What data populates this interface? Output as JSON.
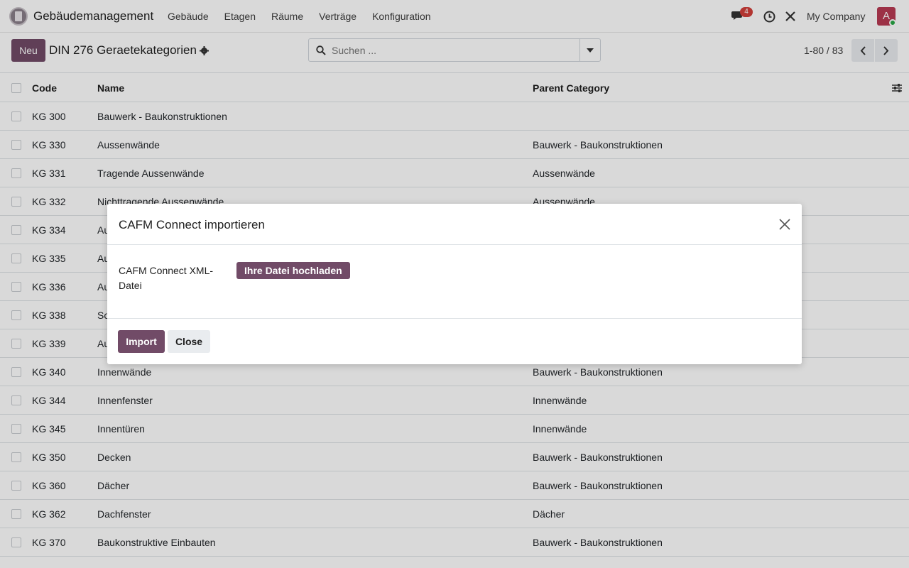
{
  "navbar": {
    "app_name": "Gebäudemanagement",
    "menu": [
      "Gebäude",
      "Etagen",
      "Räume",
      "Verträge",
      "Konfiguration"
    ],
    "chat_count": "4",
    "company": "My Company",
    "avatar_initial": "A"
  },
  "control": {
    "new_label": "Neu",
    "title": "DIN 276 Geraetekategorien",
    "search_placeholder": "Suchen ...",
    "pager": "1-80 / 83"
  },
  "table": {
    "headers": {
      "code": "Code",
      "name": "Name",
      "parent": "Parent Category"
    },
    "rows": [
      {
        "code": "KG 300",
        "name": "Bauwerk - Baukonstruktionen",
        "parent": ""
      },
      {
        "code": "KG 330",
        "name": "Aussenwände",
        "parent": "Bauwerk - Baukonstruktionen"
      },
      {
        "code": "KG 331",
        "name": "Tragende Aussenwände",
        "parent": "Aussenwände"
      },
      {
        "code": "KG 332",
        "name": "Nichttragende Aussenwände",
        "parent": "Aussenwände"
      },
      {
        "code": "KG 334",
        "name": "Au",
        "parent": ""
      },
      {
        "code": "KG 335",
        "name": "Au",
        "parent": ""
      },
      {
        "code": "KG 336",
        "name": "Au",
        "parent": ""
      },
      {
        "code": "KG 338",
        "name": "So",
        "parent": ""
      },
      {
        "code": "KG 339",
        "name": "Au",
        "parent": ""
      },
      {
        "code": "KG 340",
        "name": "Innenwände",
        "parent": "Bauwerk - Baukonstruktionen"
      },
      {
        "code": "KG 344",
        "name": "Innenfenster",
        "parent": "Innenwände"
      },
      {
        "code": "KG 345",
        "name": "Innentüren",
        "parent": "Innenwände"
      },
      {
        "code": "KG 350",
        "name": "Decken",
        "parent": "Bauwerk - Baukonstruktionen"
      },
      {
        "code": "KG 360",
        "name": "Dächer",
        "parent": "Bauwerk - Baukonstruktionen"
      },
      {
        "code": "KG 362",
        "name": "Dachfenster",
        "parent": "Dächer"
      },
      {
        "code": "KG 370",
        "name": "Baukonstruktive Einbauten",
        "parent": "Bauwerk - Baukonstruktionen"
      }
    ]
  },
  "modal": {
    "title": "CAFM Connect importieren",
    "field_label": "CAFM Connect XML-Datei",
    "upload_label": "Ihre Datei hochladen",
    "import_label": "Import",
    "close_label": "Close"
  }
}
